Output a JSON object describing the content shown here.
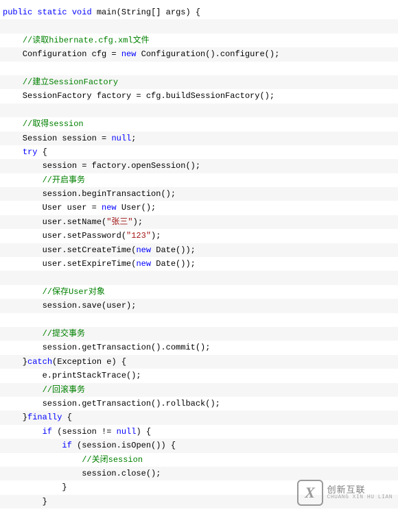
{
  "code": {
    "lines": [
      [
        {
          "t": "kw",
          "s": "public"
        },
        {
          "t": "plain",
          "s": " "
        },
        {
          "t": "kw",
          "s": "static"
        },
        {
          "t": "plain",
          "s": " "
        },
        {
          "t": "kw",
          "s": "void"
        },
        {
          "t": "plain",
          "s": " main(String[] args) {"
        }
      ],
      [],
      [
        {
          "t": "plain",
          "s": "    "
        },
        {
          "t": "cm",
          "s": "//读取hibernate.cfg.xml文件"
        }
      ],
      [
        {
          "t": "plain",
          "s": "    Configuration cfg = "
        },
        {
          "t": "kw",
          "s": "new"
        },
        {
          "t": "plain",
          "s": " Configuration().configure();"
        }
      ],
      [],
      [
        {
          "t": "plain",
          "s": "    "
        },
        {
          "t": "cm",
          "s": "//建立SessionFactory"
        }
      ],
      [
        {
          "t": "plain",
          "s": "    SessionFactory factory = cfg.buildSessionFactory();"
        }
      ],
      [],
      [
        {
          "t": "plain",
          "s": "    "
        },
        {
          "t": "cm",
          "s": "//取得session"
        }
      ],
      [
        {
          "t": "plain",
          "s": "    Session session = "
        },
        {
          "t": "kw",
          "s": "null"
        },
        {
          "t": "plain",
          "s": ";"
        }
      ],
      [
        {
          "t": "plain",
          "s": "    "
        },
        {
          "t": "kw",
          "s": "try"
        },
        {
          "t": "plain",
          "s": " {"
        }
      ],
      [
        {
          "t": "plain",
          "s": "        session = factory.openSession();"
        }
      ],
      [
        {
          "t": "plain",
          "s": "        "
        },
        {
          "t": "cm",
          "s": "//开启事务"
        }
      ],
      [
        {
          "t": "plain",
          "s": "        session.beginTransaction();"
        }
      ],
      [
        {
          "t": "plain",
          "s": "        User user = "
        },
        {
          "t": "kw",
          "s": "new"
        },
        {
          "t": "plain",
          "s": " User();"
        }
      ],
      [
        {
          "t": "plain",
          "s": "        user.setName("
        },
        {
          "t": "str",
          "s": "\"张三\""
        },
        {
          "t": "plain",
          "s": ");"
        }
      ],
      [
        {
          "t": "plain",
          "s": "        user.setPassword("
        },
        {
          "t": "str",
          "s": "\"123\""
        },
        {
          "t": "plain",
          "s": ");"
        }
      ],
      [
        {
          "t": "plain",
          "s": "        user.setCreateTime("
        },
        {
          "t": "kw",
          "s": "new"
        },
        {
          "t": "plain",
          "s": " Date());"
        }
      ],
      [
        {
          "t": "plain",
          "s": "        user.setExpireTime("
        },
        {
          "t": "kw",
          "s": "new"
        },
        {
          "t": "plain",
          "s": " Date());"
        }
      ],
      [],
      [
        {
          "t": "plain",
          "s": "        "
        },
        {
          "t": "cm",
          "s": "//保存User对象"
        }
      ],
      [
        {
          "t": "plain",
          "s": "        session.save(user);"
        }
      ],
      [],
      [
        {
          "t": "plain",
          "s": "        "
        },
        {
          "t": "cm",
          "s": "//提交事务"
        }
      ],
      [
        {
          "t": "plain",
          "s": "        session.getTransaction().commit();"
        }
      ],
      [
        {
          "t": "plain",
          "s": "    }"
        },
        {
          "t": "kw",
          "s": "catch"
        },
        {
          "t": "plain",
          "s": "(Exception e) {"
        }
      ],
      [
        {
          "t": "plain",
          "s": "        e.printStackTrace();"
        }
      ],
      [
        {
          "t": "plain",
          "s": "        "
        },
        {
          "t": "cm",
          "s": "//回滚事务"
        }
      ],
      [
        {
          "t": "plain",
          "s": "        session.getTransaction().rollback();"
        }
      ],
      [
        {
          "t": "plain",
          "s": "    }"
        },
        {
          "t": "kw",
          "s": "finally"
        },
        {
          "t": "plain",
          "s": " {"
        }
      ],
      [
        {
          "t": "plain",
          "s": "        "
        },
        {
          "t": "kw",
          "s": "if"
        },
        {
          "t": "plain",
          "s": " (session != "
        },
        {
          "t": "kw",
          "s": "null"
        },
        {
          "t": "plain",
          "s": ") {"
        }
      ],
      [
        {
          "t": "plain",
          "s": "            "
        },
        {
          "t": "kw",
          "s": "if"
        },
        {
          "t": "plain",
          "s": " (session.isOpen()) {"
        }
      ],
      [
        {
          "t": "plain",
          "s": "                "
        },
        {
          "t": "cm",
          "s": "//关闭session"
        }
      ],
      [
        {
          "t": "plain",
          "s": "                session.close();"
        }
      ],
      [
        {
          "t": "plain",
          "s": "            }"
        }
      ],
      [
        {
          "t": "plain",
          "s": "        }"
        }
      ]
    ]
  },
  "watermark": {
    "logo_text": "X",
    "brand_cn": "创新互联",
    "brand_en": "CHUANG XIN HU LIAN"
  }
}
